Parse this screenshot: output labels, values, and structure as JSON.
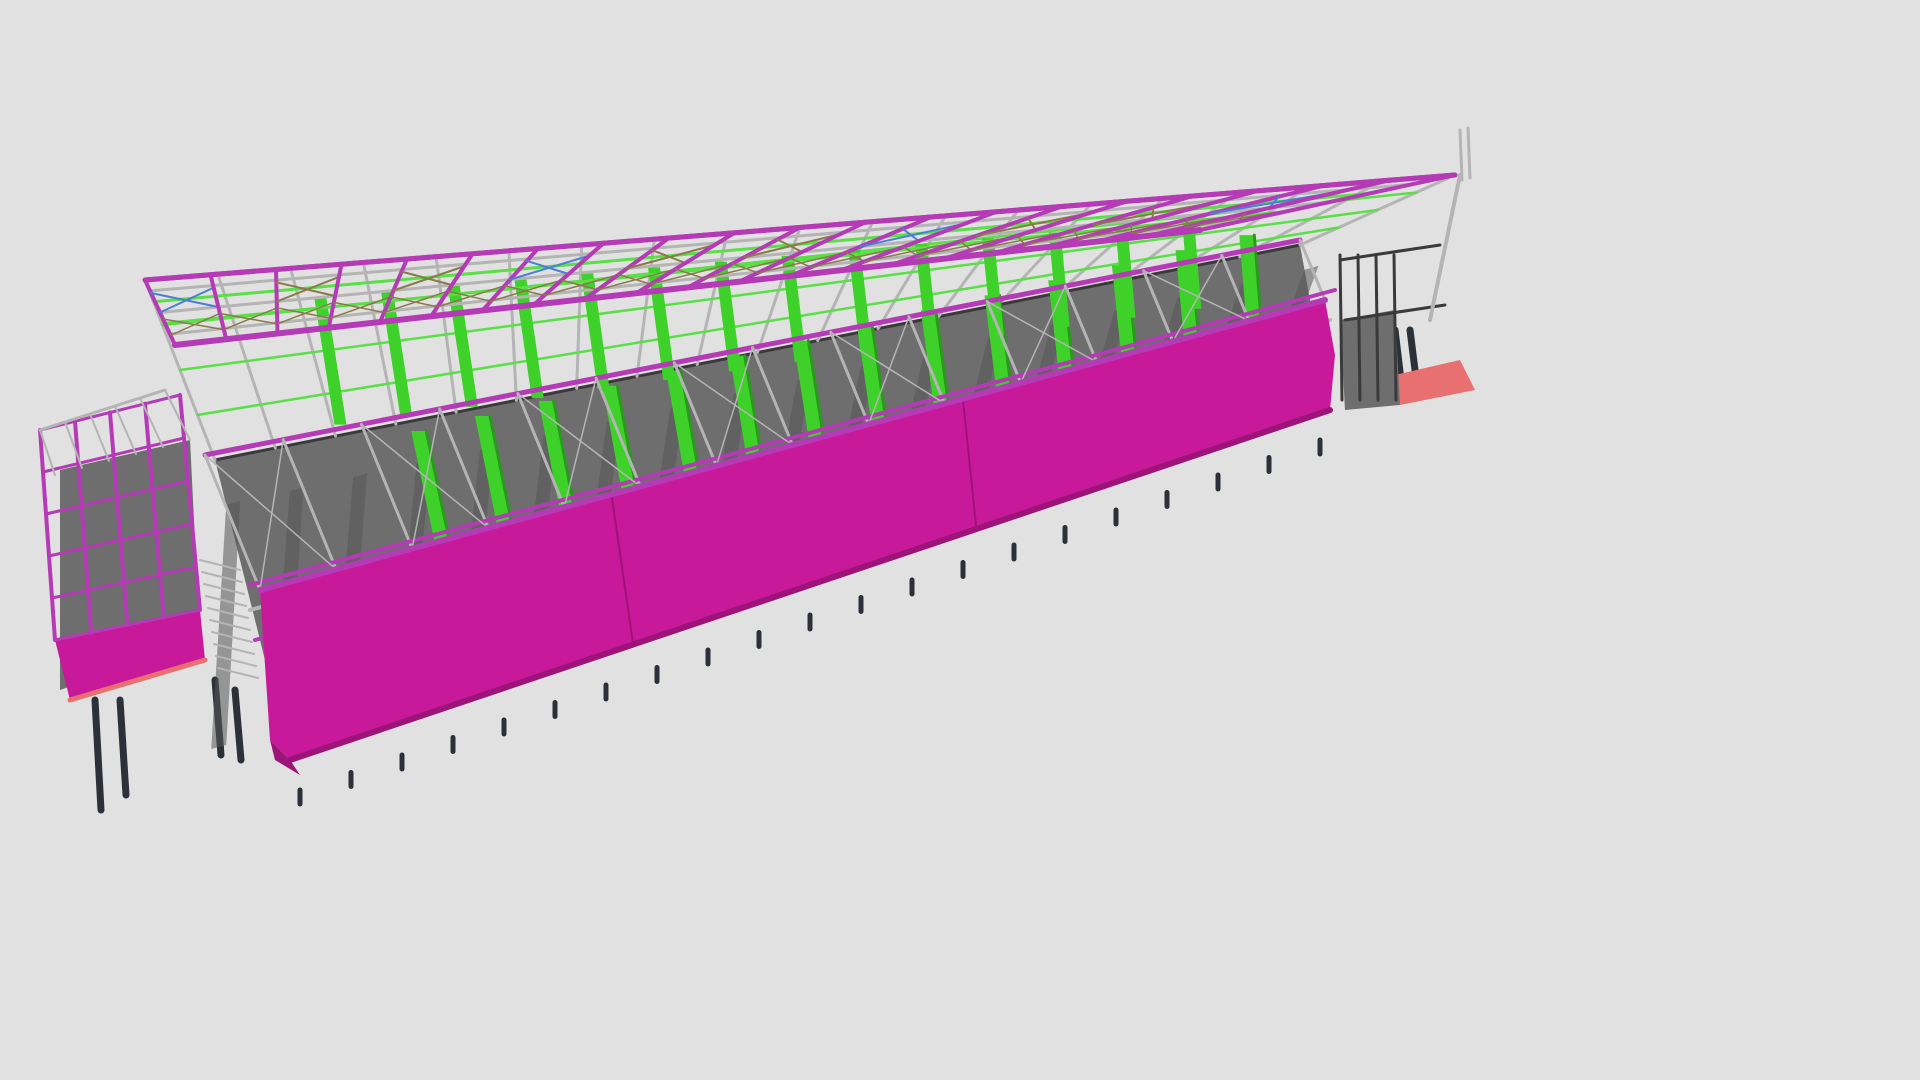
{
  "scene": {
    "background": "#e1e1e1",
    "subject": "steel-frame-building-model"
  },
  "colors": {
    "beam_magenta": "#b53ab5",
    "cladding_magenta": "#c8199b",
    "cladding_magenta_dark": "#9c1478",
    "column_green": "#3ed12a",
    "column_green_dark": "#2a9a1c",
    "purlin_green": "#58e046",
    "brace_blue": "#4a7fd6",
    "brace_olive": "#8a7a4a",
    "member_grey": "#b4b4b4",
    "member_dark": "#3a3a3a",
    "floor_grey": "#6e6e6e",
    "floor_shadow": "#575757",
    "platform_salmon": "#e87070",
    "pile_dark": "#2c3038"
  }
}
